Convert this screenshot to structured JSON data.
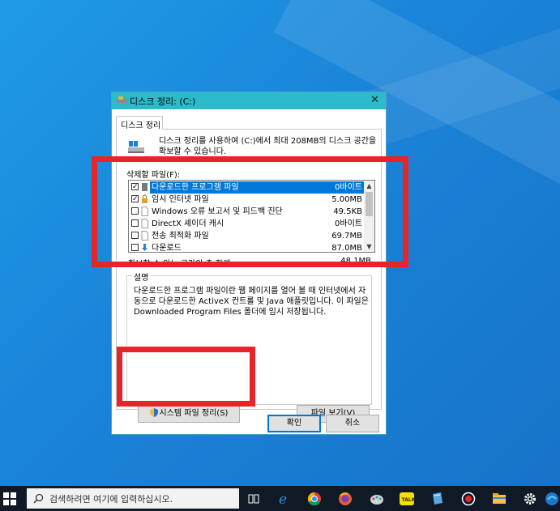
{
  "dialog": {
    "title": "디스크 정리: (C:)",
    "close_glyph": "✕",
    "tab_label": "디스크 정리",
    "intro_text": "디스크 정리를 사용하여 (C:)에서 최대 208MB의 디스크 공간을 확보할 수 있습니다.",
    "files_label": "삭제할 파일(F):",
    "files": [
      {
        "name": "다운로드한 프로그램 파일",
        "size": "0바이트",
        "checked": true,
        "selected": true,
        "icon": "folder-icon"
      },
      {
        "name": "임시 인터넷 파일",
        "size": "5.00MB",
        "checked": true,
        "selected": false,
        "icon": "lock-icon"
      },
      {
        "name": "Windows 오류 보고서 및 피드백 진단",
        "size": "49.5KB",
        "checked": false,
        "selected": false,
        "icon": "file-icon"
      },
      {
        "name": "DirectX 셰이더 캐시",
        "size": "0바이트",
        "checked": false,
        "selected": false,
        "icon": "file-icon"
      },
      {
        "name": "전송 최적화 파일",
        "size": "69.7MB",
        "checked": false,
        "selected": false,
        "icon": "file-icon"
      },
      {
        "name": "다운로드",
        "size": "87.0MB",
        "checked": false,
        "selected": false,
        "icon": "download-icon"
      }
    ],
    "total_label": "확보할 수 있는 공간의 총 합계:",
    "total_value": "48.1MB",
    "desc_legend": "설명",
    "desc_text": "다운로드한 프로그램 파일이란 웹 페이지를 열어 볼 때 인터넷에서 자동으로 다운로드한 ActiveX 컨트롤 및 Java 애플릿입니다. 이 파일은 Downloaded Program Files 폴더에 임시 저장됩니다.",
    "sys_cleanup_label": "시스템 파일 정리(S)",
    "view_files_label": "파일 보기(V)",
    "ok_label": "확인",
    "cancel_label": "취소"
  },
  "taskbar": {
    "search_placeholder": "검색하려면 여기에 입력하십시오.",
    "icons": [
      "task-view-icon",
      "edge-icon",
      "chrome-icon",
      "firefox-icon",
      "paint-icon",
      "kakaotalk-icon",
      "notepad-icon",
      "record-icon",
      "file-explorer-icon",
      "settings-icon",
      "edge-blue-icon"
    ]
  },
  "colors": {
    "desktop": "#1a84d8",
    "titlebar": "#2bbbcb",
    "selection": "#0078d7",
    "annotation": "#e6252a",
    "taskbar": "#0f1a26"
  }
}
